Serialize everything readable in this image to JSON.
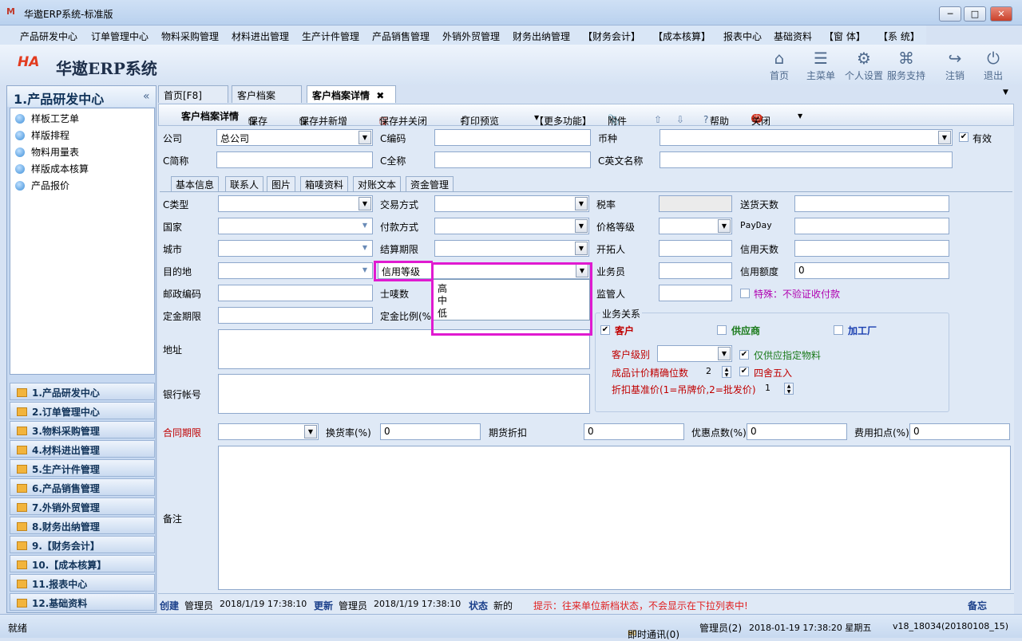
{
  "window": {
    "title": "华遨ERP系统-标准版"
  },
  "menu": [
    "产品研发中心",
    "订单管理中心",
    "物料采购管理",
    "材料进出管理",
    "生产计件管理",
    "产品销售管理",
    "外销外贸管理",
    "财务出纳管理",
    "【财务会计】",
    "【成本核算】",
    "报表中心",
    "基础资料",
    "【窗 体】",
    "【系 统】"
  ],
  "brand": {
    "name": "华遨ERP系统",
    "logo": "HA"
  },
  "header_buttons": [
    {
      "label": "首页",
      "icon": "home-icon"
    },
    {
      "label": "主菜单",
      "icon": "list-icon"
    },
    {
      "label": "个人设置",
      "icon": "gear-icon"
    },
    {
      "label": "服务支持",
      "icon": "support-icon"
    },
    {
      "label": "注销",
      "icon": "logout-icon"
    },
    {
      "label": "退出",
      "icon": "power-icon"
    }
  ],
  "left": {
    "title": "1.产品研发中心",
    "tree": [
      "样板工艺单",
      "样版排程",
      "物料用量表",
      "样版成本核算",
      "产品报价"
    ],
    "nav": [
      "1.产品研发中心",
      "2.订单管理中心",
      "3.物料采购管理",
      "4.材料进出管理",
      "5.生产计件管理",
      "6.产品销售管理",
      "7.外销外贸管理",
      "8.财务出纳管理",
      "9.【财务会计】",
      "10.【成本核算】",
      "11.报表中心",
      "12.基础资料"
    ]
  },
  "tabs": [
    "首页[F8]",
    "客户档案",
    "客户档案详情"
  ],
  "toolbar": {
    "title": "客户档案详情",
    "save": "保存",
    "save_new": "保存并新增",
    "save_close": "保存并关闭",
    "print": "打印预览",
    "more": "【更多功能】",
    "attach": "附件",
    "help": "帮助",
    "close": "关闭"
  },
  "top_fields": {
    "company_label": "公司",
    "company_value": "总公司",
    "code_label": "C编码",
    "currency_label": "币种",
    "valid_label": "有效",
    "short_label": "C简称",
    "full_label": "C全称",
    "en_label": "C英文名称"
  },
  "subtabs": [
    "基本信息",
    "联系人",
    "图片",
    "箱唛资料",
    "对账文本",
    "资金管理"
  ],
  "fields": {
    "ctype": "C类型",
    "country": "国家",
    "city": "城市",
    "dest": "目的地",
    "post": "邮政编码",
    "deposit": "定金期限",
    "trade": "交易方式",
    "pay": "付款方式",
    "settle": "结算期限",
    "credit": "信用等级",
    "mark": "士唛数",
    "deposit_ratio": "定金比例(%)",
    "tax": "税率",
    "price_level": "价格等级",
    "developer": "开拓人",
    "salesman": "业务员",
    "supervisor": "监管人",
    "delivery": "送货天数",
    "payday": "PayDay",
    "credit_days": "信用天数",
    "credit_limit": "信用额度",
    "credit_limit_value": "0",
    "special": "特殊：不验证收付款",
    "address": "地址",
    "bank": "银行帐号"
  },
  "dropdown": {
    "options": [
      "高",
      "中",
      "低"
    ]
  },
  "biz": {
    "title": "业务关系",
    "customer": "客户",
    "supplier": "供应商",
    "factory": "加工厂",
    "level": "客户级别",
    "only_supply": "仅供应指定物料",
    "precision": "成品计价精确位数",
    "precision_value": "2",
    "round": "四舍五入",
    "discount": "折扣基准价(1=吊牌价,2=批发价)",
    "discount_value": "1"
  },
  "contract": {
    "label": "合同期限",
    "exchange": "换货率(%)",
    "exchange_value": "0",
    "futures": "期货折扣",
    "futures_value": "0",
    "pref": "优惠点数(%)",
    "pref_value": "0",
    "fee": "费用扣点(%)",
    "fee_value": "0",
    "remark": "备注"
  },
  "status": {
    "created": "创建",
    "creator": "管理员",
    "ctime": "2018/1/19 17:38:10",
    "updated": "更新",
    "updater": "管理员",
    "utime": "2018/1/19 17:38:10",
    "state": "状态",
    "state_value": "新的",
    "hint": "提示：往来单位新档状态，不会显示在下拉列表中!",
    "memo": "备忘"
  },
  "bottom": {
    "ready": "就绪",
    "im": "即时通讯(0)",
    "user": "管理员(2)",
    "datetime": "2018-01-19  17:38:20 星期五",
    "version": "v18_18034(20180108_15)"
  },
  "colors": {
    "highlight": "#e01ad0",
    "red_label": "#c00000",
    "green_label": "#1a7a1a",
    "blue_label": "#1a3fb0"
  }
}
